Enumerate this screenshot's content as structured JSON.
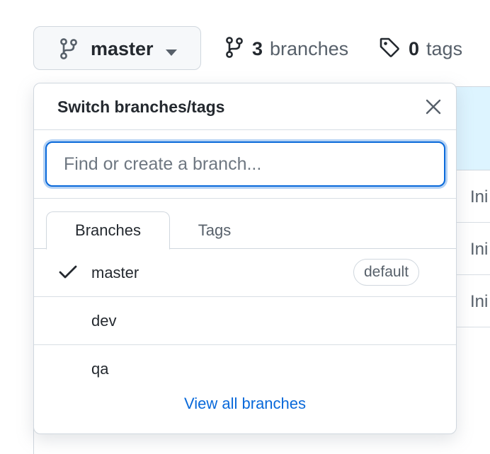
{
  "toolbar": {
    "branch_button_label": "master",
    "branches_count": "3",
    "branches_word": "branches",
    "tags_count": "0",
    "tags_word": "tags"
  },
  "background_rows": [
    {
      "text": "Ini"
    },
    {
      "text": "Ini"
    },
    {
      "text": "Ini"
    }
  ],
  "dropdown": {
    "title": "Switch branches/tags",
    "search_placeholder": "Find or create a branch...",
    "tabs": [
      {
        "label": "Branches",
        "selected": true
      },
      {
        "label": "Tags",
        "selected": false
      }
    ],
    "items": [
      {
        "name": "master",
        "checked": true,
        "badge": "default"
      },
      {
        "name": "dev",
        "checked": false
      },
      {
        "name": "qa",
        "checked": false
      }
    ],
    "footer_link": "View all branches"
  },
  "icons": {
    "branch": "git-branch-icon",
    "tag": "tag-icon",
    "caret": "triangle-down-icon",
    "close": "x-icon",
    "check": "check-icon"
  },
  "colors": {
    "accent": "#0969da",
    "border": "#d0d7de",
    "text": "#24292f",
    "muted": "#57606a"
  }
}
